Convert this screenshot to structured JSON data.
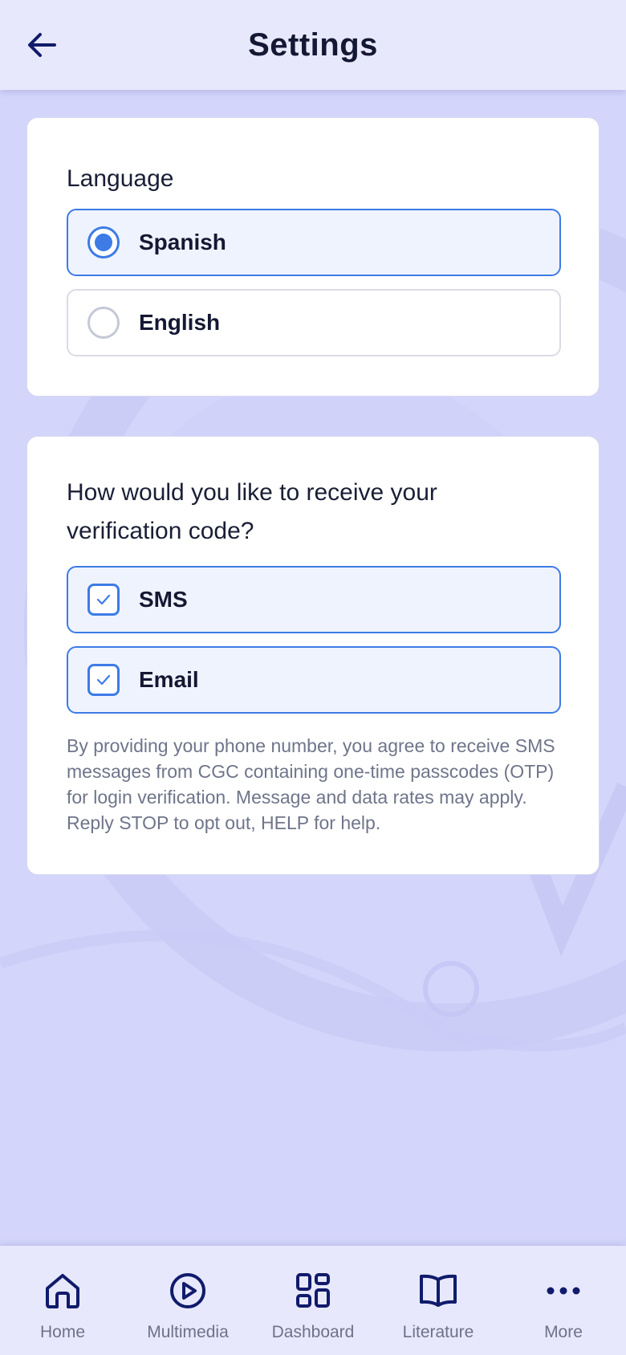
{
  "header": {
    "title": "Settings"
  },
  "language_card": {
    "heading": "Language",
    "options": [
      {
        "label": "Spanish",
        "selected": true
      },
      {
        "label": "English",
        "selected": false
      }
    ]
  },
  "verification_card": {
    "heading_line1": "How would you like to receive your",
    "heading_line2": "verification code?",
    "options": [
      {
        "label": "SMS",
        "checked": true
      },
      {
        "label": "Email",
        "checked": true
      }
    ],
    "disclaimer": "By providing your phone number, you agree to receive SMS messages from CGC containing one-time passcodes (OTP) for login verification. Message and data rates may apply. Reply STOP to opt out, HELP for help."
  },
  "bottom_nav": {
    "items": [
      {
        "label": "Home",
        "icon": "home-icon"
      },
      {
        "label": "Multimedia",
        "icon": "play-circle-icon"
      },
      {
        "label": "Dashboard",
        "icon": "grid-icon"
      },
      {
        "label": "Literature",
        "icon": "book-icon"
      },
      {
        "label": "More",
        "icon": "more-dots-icon"
      }
    ]
  },
  "colors": {
    "accent": "#3d7be6",
    "nav_icon": "#101b6b",
    "background": "#d4d5fb",
    "header_bg": "#e8e8fd",
    "text_primary": "#141833",
    "text_muted": "#6f758a"
  }
}
